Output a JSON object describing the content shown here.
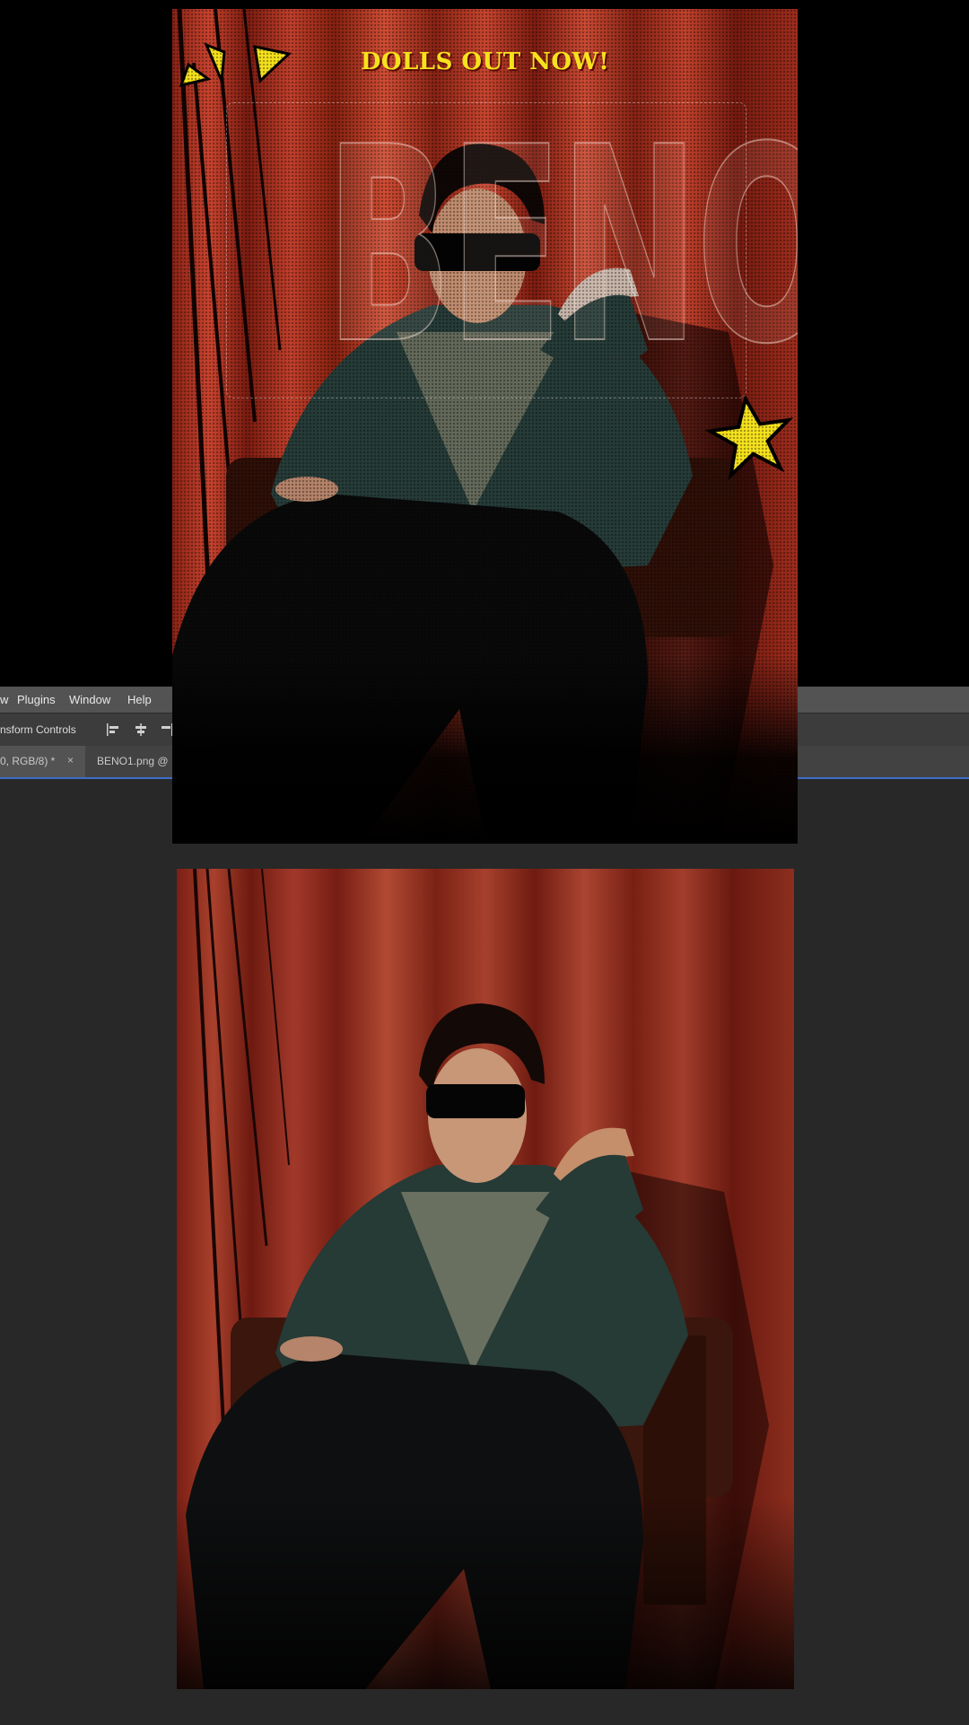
{
  "menubar": {
    "items": [
      "w",
      "Plugins",
      "Window",
      "Help"
    ]
  },
  "options_bar": {
    "transform_controls_label": "nsform Controls"
  },
  "tabs": [
    {
      "label": "0, RGB/8) *",
      "close": "×"
    },
    {
      "label": "BENO1.png @"
    }
  ],
  "poster": {
    "headline": "DOLLS OUT NOW!",
    "name": "BENO"
  },
  "colors": {
    "accent_yellow": "#f6e21c",
    "curtain_red": "#8e2a1c",
    "menubar_bg": "#535353",
    "workspace_bg": "#282828",
    "selection_blue": "#3b6ec7"
  },
  "icons": [
    "align-left-icon",
    "align-center-icon",
    "align-right-icon",
    "burst-icon",
    "star-icon"
  ]
}
